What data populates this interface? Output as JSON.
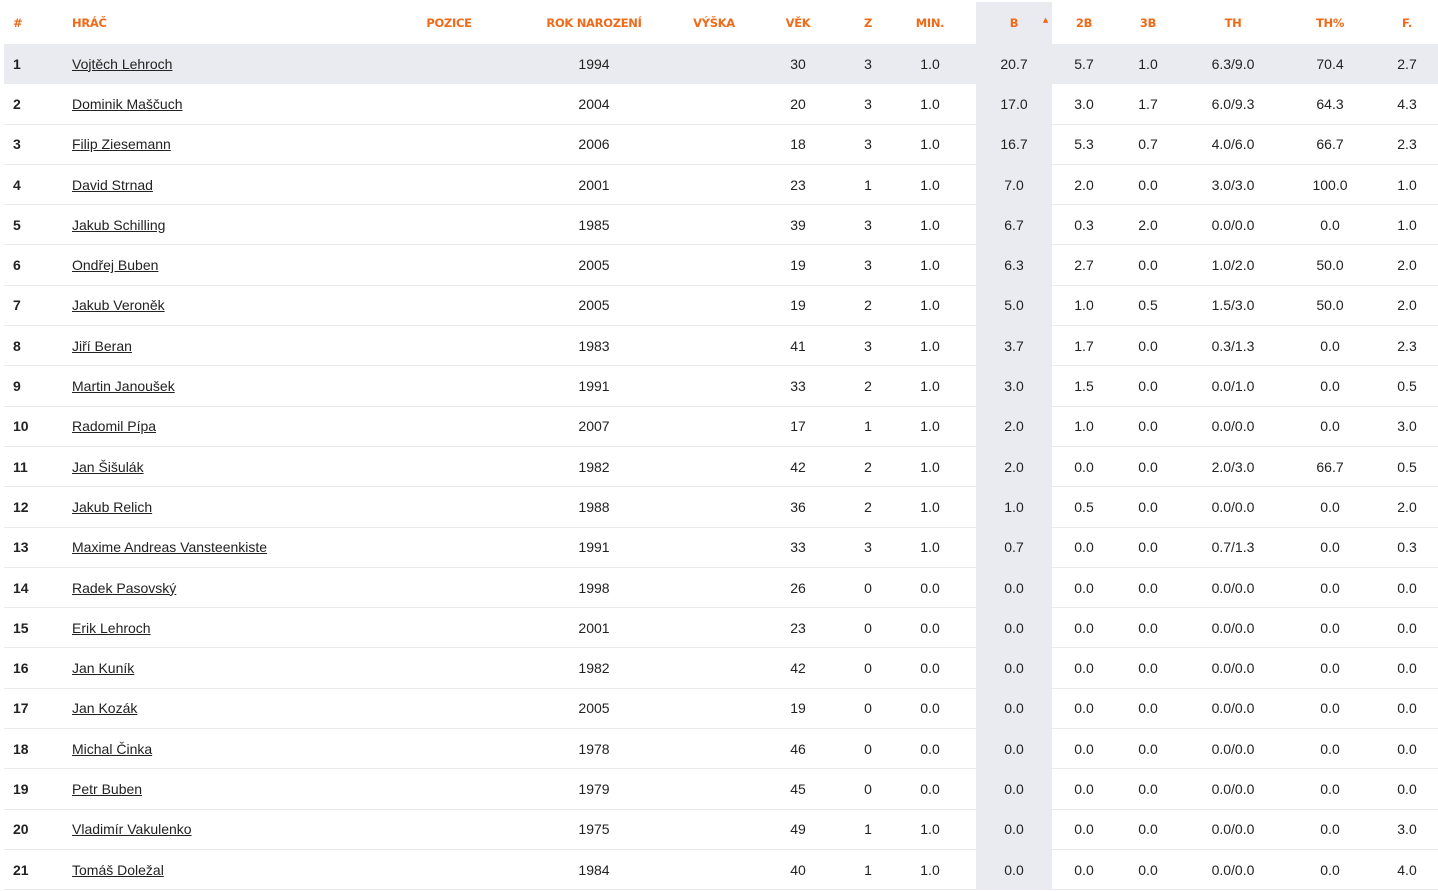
{
  "table": {
    "headers": {
      "rank": "#",
      "name": "HRÁČ",
      "position": "POZICE",
      "birth_year": "ROK NAROZENÍ",
      "height": "VÝŠKA",
      "age": "VĚK",
      "games": "Z",
      "minutes": "MIN.",
      "points": "B",
      "two_pt": "2B",
      "three_pt": "3B",
      "free_throws": "TH",
      "free_throw_pct": "TH%",
      "fouls": "F."
    },
    "sort_indicator": "▲",
    "rows": [
      {
        "rank": "1",
        "name": "Vojtěch Lehroch",
        "position": "",
        "birth_year": "1994",
        "height": "",
        "age": "30",
        "games": "3",
        "minutes": "1.0",
        "points": "20.7",
        "two_pt": "5.7",
        "three_pt": "1.0",
        "free_throws": "6.3/9.0",
        "free_throw_pct": "70.4",
        "fouls": "2.7"
      },
      {
        "rank": "2",
        "name": "Dominik Maščuch",
        "position": "",
        "birth_year": "2004",
        "height": "",
        "age": "20",
        "games": "3",
        "minutes": "1.0",
        "points": "17.0",
        "two_pt": "3.0",
        "three_pt": "1.7",
        "free_throws": "6.0/9.3",
        "free_throw_pct": "64.3",
        "fouls": "4.3"
      },
      {
        "rank": "3",
        "name": "Filip Ziesemann",
        "position": "",
        "birth_year": "2006",
        "height": "",
        "age": "18",
        "games": "3",
        "minutes": "1.0",
        "points": "16.7",
        "two_pt": "5.3",
        "three_pt": "0.7",
        "free_throws": "4.0/6.0",
        "free_throw_pct": "66.7",
        "fouls": "2.3"
      },
      {
        "rank": "4",
        "name": "David Strnad",
        "position": "",
        "birth_year": "2001",
        "height": "",
        "age": "23",
        "games": "1",
        "minutes": "1.0",
        "points": "7.0",
        "two_pt": "2.0",
        "three_pt": "0.0",
        "free_throws": "3.0/3.0",
        "free_throw_pct": "100.0",
        "fouls": "1.0"
      },
      {
        "rank": "5",
        "name": "Jakub Schilling",
        "position": "",
        "birth_year": "1985",
        "height": "",
        "age": "39",
        "games": "3",
        "minutes": "1.0",
        "points": "6.7",
        "two_pt": "0.3",
        "three_pt": "2.0",
        "free_throws": "0.0/0.0",
        "free_throw_pct": "0.0",
        "fouls": "1.0"
      },
      {
        "rank": "6",
        "name": "Ondřej Buben",
        "position": "",
        "birth_year": "2005",
        "height": "",
        "age": "19",
        "games": "3",
        "minutes": "1.0",
        "points": "6.3",
        "two_pt": "2.7",
        "three_pt": "0.0",
        "free_throws": "1.0/2.0",
        "free_throw_pct": "50.0",
        "fouls": "2.0"
      },
      {
        "rank": "7",
        "name": "Jakub Veroněk",
        "position": "",
        "birth_year": "2005",
        "height": "",
        "age": "19",
        "games": "2",
        "minutes": "1.0",
        "points": "5.0",
        "two_pt": "1.0",
        "three_pt": "0.5",
        "free_throws": "1.5/3.0",
        "free_throw_pct": "50.0",
        "fouls": "2.0"
      },
      {
        "rank": "8",
        "name": "Jiří Beran",
        "position": "",
        "birth_year": "1983",
        "height": "",
        "age": "41",
        "games": "3",
        "minutes": "1.0",
        "points": "3.7",
        "two_pt": "1.7",
        "three_pt": "0.0",
        "free_throws": "0.3/1.3",
        "free_throw_pct": "0.0",
        "fouls": "2.3"
      },
      {
        "rank": "9",
        "name": "Martin Janoušek",
        "position": "",
        "birth_year": "1991",
        "height": "",
        "age": "33",
        "games": "2",
        "minutes": "1.0",
        "points": "3.0",
        "two_pt": "1.5",
        "three_pt": "0.0",
        "free_throws": "0.0/1.0",
        "free_throw_pct": "0.0",
        "fouls": "0.5"
      },
      {
        "rank": "10",
        "name": "Radomil Pípa",
        "position": "",
        "birth_year": "2007",
        "height": "",
        "age": "17",
        "games": "1",
        "minutes": "1.0",
        "points": "2.0",
        "two_pt": "1.0",
        "three_pt": "0.0",
        "free_throws": "0.0/0.0",
        "free_throw_pct": "0.0",
        "fouls": "3.0"
      },
      {
        "rank": "11",
        "name": "Jan Šišulák",
        "position": "",
        "birth_year": "1982",
        "height": "",
        "age": "42",
        "games": "2",
        "minutes": "1.0",
        "points": "2.0",
        "two_pt": "0.0",
        "three_pt": "0.0",
        "free_throws": "2.0/3.0",
        "free_throw_pct": "66.7",
        "fouls": "0.5"
      },
      {
        "rank": "12",
        "name": "Jakub Relich",
        "position": "",
        "birth_year": "1988",
        "height": "",
        "age": "36",
        "games": "2",
        "minutes": "1.0",
        "points": "1.0",
        "two_pt": "0.5",
        "three_pt": "0.0",
        "free_throws": "0.0/0.0",
        "free_throw_pct": "0.0",
        "fouls": "2.0"
      },
      {
        "rank": "13",
        "name": "Maxime Andreas Vansteenkiste",
        "position": "",
        "birth_year": "1991",
        "height": "",
        "age": "33",
        "games": "3",
        "minutes": "1.0",
        "points": "0.7",
        "two_pt": "0.0",
        "three_pt": "0.0",
        "free_throws": "0.7/1.3",
        "free_throw_pct": "0.0",
        "fouls": "0.3"
      },
      {
        "rank": "14",
        "name": "Radek Pasovský",
        "position": "",
        "birth_year": "1998",
        "height": "",
        "age": "26",
        "games": "0",
        "minutes": "0.0",
        "points": "0.0",
        "two_pt": "0.0",
        "three_pt": "0.0",
        "free_throws": "0.0/0.0",
        "free_throw_pct": "0.0",
        "fouls": "0.0"
      },
      {
        "rank": "15",
        "name": "Erik Lehroch",
        "position": "",
        "birth_year": "2001",
        "height": "",
        "age": "23",
        "games": "0",
        "minutes": "0.0",
        "points": "0.0",
        "two_pt": "0.0",
        "three_pt": "0.0",
        "free_throws": "0.0/0.0",
        "free_throw_pct": "0.0",
        "fouls": "0.0"
      },
      {
        "rank": "16",
        "name": "Jan Kuník",
        "position": "",
        "birth_year": "1982",
        "height": "",
        "age": "42",
        "games": "0",
        "minutes": "0.0",
        "points": "0.0",
        "two_pt": "0.0",
        "three_pt": "0.0",
        "free_throws": "0.0/0.0",
        "free_throw_pct": "0.0",
        "fouls": "0.0"
      },
      {
        "rank": "17",
        "name": "Jan Kozák",
        "position": "",
        "birth_year": "2005",
        "height": "",
        "age": "19",
        "games": "0",
        "minutes": "0.0",
        "points": "0.0",
        "two_pt": "0.0",
        "three_pt": "0.0",
        "free_throws": "0.0/0.0",
        "free_throw_pct": "0.0",
        "fouls": "0.0"
      },
      {
        "rank": "18",
        "name": "Michal Činka",
        "position": "",
        "birth_year": "1978",
        "height": "",
        "age": "46",
        "games": "0",
        "minutes": "0.0",
        "points": "0.0",
        "two_pt": "0.0",
        "three_pt": "0.0",
        "free_throws": "0.0/0.0",
        "free_throw_pct": "0.0",
        "fouls": "0.0"
      },
      {
        "rank": "19",
        "name": "Petr Buben",
        "position": "",
        "birth_year": "1979",
        "height": "",
        "age": "45",
        "games": "0",
        "minutes": "0.0",
        "points": "0.0",
        "two_pt": "0.0",
        "three_pt": "0.0",
        "free_throws": "0.0/0.0",
        "free_throw_pct": "0.0",
        "fouls": "0.0"
      },
      {
        "rank": "20",
        "name": "Vladimír Vakulenko",
        "position": "",
        "birth_year": "1975",
        "height": "",
        "age": "49",
        "games": "1",
        "minutes": "1.0",
        "points": "0.0",
        "two_pt": "0.0",
        "three_pt": "0.0",
        "free_throws": "0.0/0.0",
        "free_throw_pct": "0.0",
        "fouls": "3.0"
      },
      {
        "rank": "21",
        "name": "Tomáš Doležal",
        "position": "",
        "birth_year": "1984",
        "height": "",
        "age": "40",
        "games": "1",
        "minutes": "1.0",
        "points": "0.0",
        "two_pt": "0.0",
        "three_pt": "0.0",
        "free_throws": "0.0/0.0",
        "free_throw_pct": "0.0",
        "fouls": "4.0"
      }
    ]
  },
  "colors": {
    "header_text": "#f06a1a",
    "highlight_bg": "#e9ebf1",
    "row_border": "#e8eaee"
  }
}
